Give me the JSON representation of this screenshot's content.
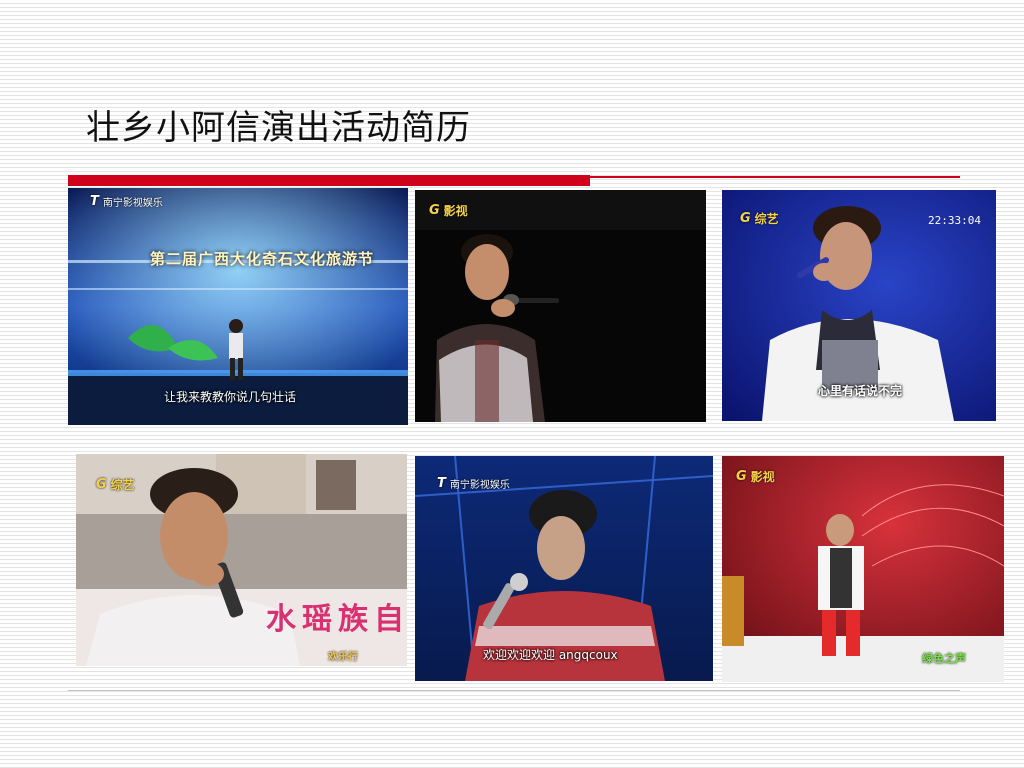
{
  "slide": {
    "title": "壮乡小阿信演出活动简历"
  },
  "photos": [
    {
      "logo_mark": "T",
      "logo_text": "南宁影视娱乐",
      "banner": "第二届广西大化奇石文化旅游节",
      "caption": "让我来教教你说几句壮话"
    },
    {
      "logo_mark": "G",
      "logo_text": "影视"
    },
    {
      "logo_mark": "G",
      "logo_text": "综艺",
      "clock": "22:33:04",
      "caption": "心里有话说不完"
    },
    {
      "logo_mark": "G",
      "logo_text": "综艺",
      "sign": "水瑶族自",
      "corner_text": "欢乐行"
    },
    {
      "logo_mark": "T",
      "logo_text": "南宁影视娱乐",
      "caption": "欢迎欢迎欢迎 angqcoux"
    },
    {
      "logo_mark": "G",
      "logo_text": "影视",
      "corner_text": "绿色之声"
    }
  ],
  "colors": {
    "accent_rule": "#d0021b",
    "background": "#ffffff"
  }
}
